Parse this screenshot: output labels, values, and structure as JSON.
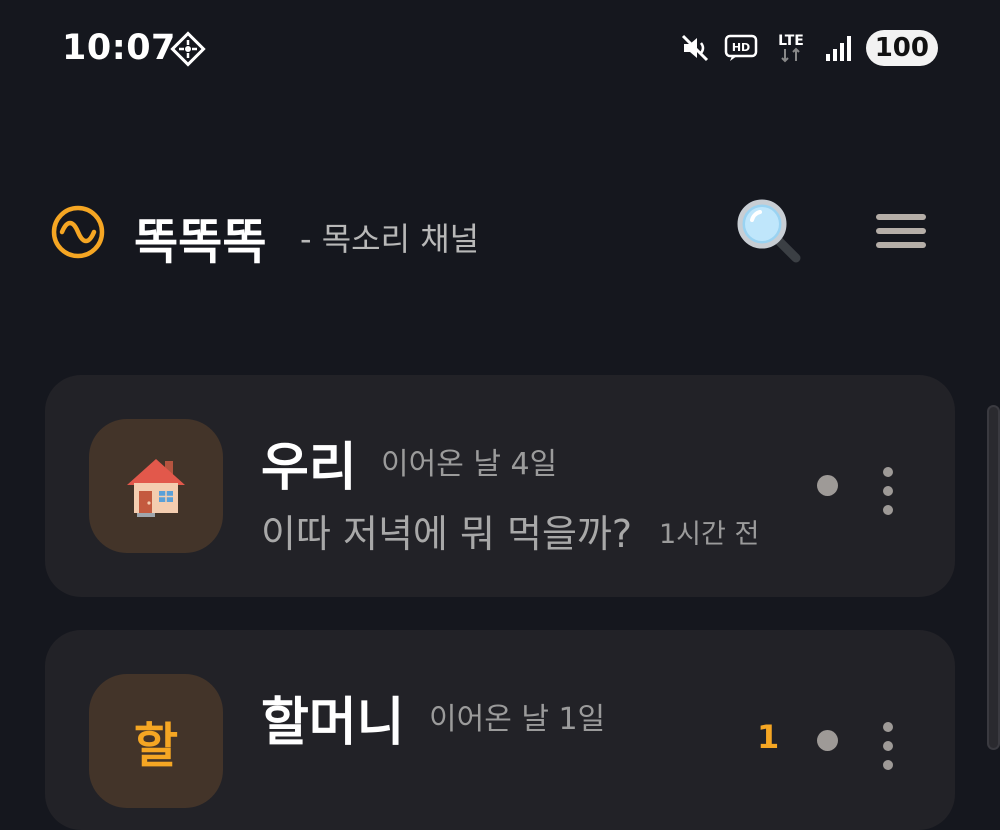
{
  "status_bar": {
    "time": "10:07",
    "network": "LTE",
    "battery": "100",
    "icons": [
      "vpn-icon",
      "mute-icon",
      "hd-voice-icon",
      "lte-data-icon",
      "signal-icon"
    ]
  },
  "app_bar": {
    "title": "똑똑똑",
    "subtitle": "- 목소리 채널",
    "logo_icon": "wave-circle-icon",
    "search_icon": "magnifier-icon",
    "menu_icon": "hamburger-icon"
  },
  "channels": [
    {
      "avatar_emoji": "🏠",
      "name": "우리",
      "streak": "이어온 날 4일",
      "last_message": "이따 저녁에 뭐 먹을까?",
      "time": "1시간 전"
    },
    {
      "avatar_letter": "할",
      "name": "할머니",
      "streak": "이어온 날 1일",
      "unread": "1"
    }
  ],
  "colors": {
    "background": "#15171e",
    "card": "#222227",
    "accent": "#f5a623",
    "avatar_bg": "#433429"
  }
}
